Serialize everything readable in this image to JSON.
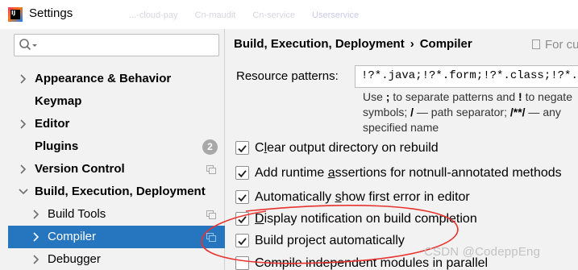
{
  "window": {
    "title": "Settings",
    "ghost_tabs": [
      "...-cloud-pay",
      "Cn-maudit",
      "Cn-service",
      "Userservice"
    ]
  },
  "search": {
    "placeholder": "",
    "value": ""
  },
  "tree": {
    "items": [
      {
        "label": "Appearance & Behavior",
        "bold": true,
        "chevron": true,
        "level": 0
      },
      {
        "label": "Keymap",
        "bold": true,
        "chevron": false,
        "level": 0
      },
      {
        "label": "Editor",
        "bold": true,
        "chevron": true,
        "level": 0
      },
      {
        "label": "Plugins",
        "bold": true,
        "chevron": false,
        "level": 0,
        "badge": "2"
      },
      {
        "label": "Version Control",
        "bold": true,
        "chevron": true,
        "level": 0,
        "project_icon": true
      },
      {
        "label": "Build, Execution, Deployment",
        "bold": true,
        "chevron": "down",
        "level": 0
      },
      {
        "label": "Build Tools",
        "bold": false,
        "chevron": true,
        "level": 1,
        "project_icon": true
      },
      {
        "label": "Compiler",
        "bold": false,
        "chevron": true,
        "level": 1,
        "project_icon": true,
        "selected": true
      },
      {
        "label": "Debugger",
        "bold": false,
        "chevron": true,
        "level": 1
      }
    ]
  },
  "breadcrumb": {
    "parent": "Build, Execution, Deployment",
    "separator": "›",
    "current": "Compiler",
    "for_current": "For cu"
  },
  "resource_patterns": {
    "label": "Resource patterns:",
    "value": "!?*.java;!?*.form;!?*.class;!?*.gr",
    "hint_line1_a": "Use ",
    "hint_line1_b": ";",
    "hint_line1_c": " to separate patterns and ",
    "hint_line1_d": "!",
    "hint_line1_e": " to negate",
    "hint_line2_a": "symbols; ",
    "hint_line2_b": "/",
    "hint_line2_c": " — path separator; ",
    "hint_line2_d": "/**/",
    "hint_line2_e": " — any",
    "hint_line3": "specified name"
  },
  "options": [
    {
      "pre": "C",
      "mn": "l",
      "post": "ear output directory on rebuild",
      "checked": true
    },
    {
      "pre": "Add runtime ",
      "mn": "a",
      "post": "ssertions for notnull-annotated methods",
      "checked": true
    },
    {
      "pre": "Automatically ",
      "mn": "s",
      "post": "how first error in editor",
      "checked": true
    },
    {
      "pre": "",
      "mn": "D",
      "post": "isplay notification on build completion",
      "checked": true
    },
    {
      "pre": "Build project automatically",
      "mn": "",
      "post": "",
      "checked": true
    },
    {
      "pre": "Compile independent modules in parallel",
      "mn": "",
      "post": "",
      "checked": false
    }
  ],
  "watermark": "CSDN @CodeppEng",
  "colors": {
    "selection": "#2675bf",
    "checkbox_blue": "#3a6fd6",
    "annotation_red": "#e8332f",
    "badge": "#a8a8a8"
  }
}
